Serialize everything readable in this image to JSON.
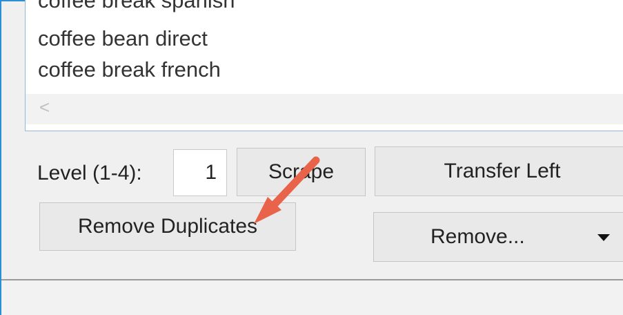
{
  "list": {
    "items": [
      "coffee break spanish",
      "coffee bean direct",
      "coffee break french"
    ],
    "scroll_left_glyph": "<"
  },
  "controls": {
    "level_label": "Level (1-4):",
    "level_value": "1",
    "scrape_label": "Scrape",
    "transfer_left_label": "Transfer Left",
    "remove_duplicates_label": "Remove Duplicates",
    "remove_label": "Remove..."
  },
  "annotation": {
    "arrow_color": "#e8634a",
    "arrow_icon": "pointer-arrow-icon"
  },
  "colors": {
    "window_border": "#2b8fd6",
    "button_bg": "#e9e9e9"
  }
}
